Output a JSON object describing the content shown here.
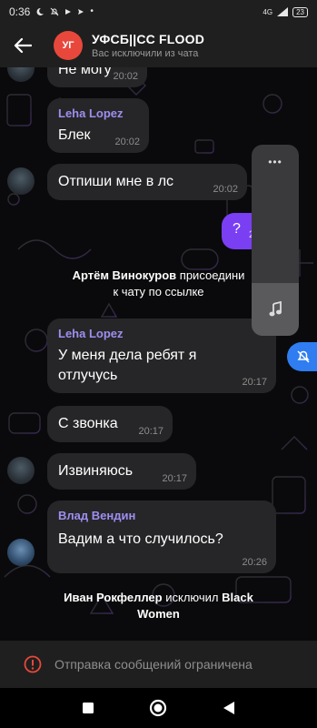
{
  "status_bar": {
    "time": "0:36",
    "network": "4G",
    "battery": "23"
  },
  "header": {
    "avatar_initials": "УГ",
    "avatar_color": "#e8483b",
    "title": "УФСБ||СС FLOOD",
    "subtitle": "Вас исключили из чата"
  },
  "messages": [
    {
      "text": "Не могу",
      "time": "20:02"
    },
    {
      "sender": "Leha Lopez",
      "text": "Блек",
      "time": "20:02"
    },
    {
      "text": "Отпиши мне в лс",
      "time": "20:02"
    },
    {
      "self": true,
      "text": "?",
      "time": "2"
    },
    {
      "sender": "Leha Lopez",
      "text_line1": "У меня дела ребят я",
      "text_line2": "отлучусь",
      "time": "20:17"
    },
    {
      "text": "С звонка",
      "time": "20:17"
    },
    {
      "text": "Извиняюсь",
      "time": "20:17"
    },
    {
      "sender": "Влад Вендин",
      "text": "Вадим а что случилось?",
      "time": "20:26"
    }
  ],
  "service_messages": {
    "join": {
      "actor": "Артём Винокуров",
      "action": " присоедини",
      "line2": "к чату по ссылке"
    },
    "kick": {
      "actor": "Иван Рокфеллер",
      "action": " исключил ",
      "target1": "Black",
      "target2": "Women"
    }
  },
  "media_panel": {
    "dots": "•••",
    "icon": "music-note-icon"
  },
  "mute_button": {
    "icon": "muted-bell-icon",
    "color": "#2f7df0"
  },
  "restriction": {
    "icon": "warning-circle-icon",
    "text": "Отправка сообщений ограничена",
    "icon_color": "#e8483b"
  },
  "accent": {
    "sender_color": "#9f8ef0",
    "self_bubble": "#7a3ff2"
  }
}
